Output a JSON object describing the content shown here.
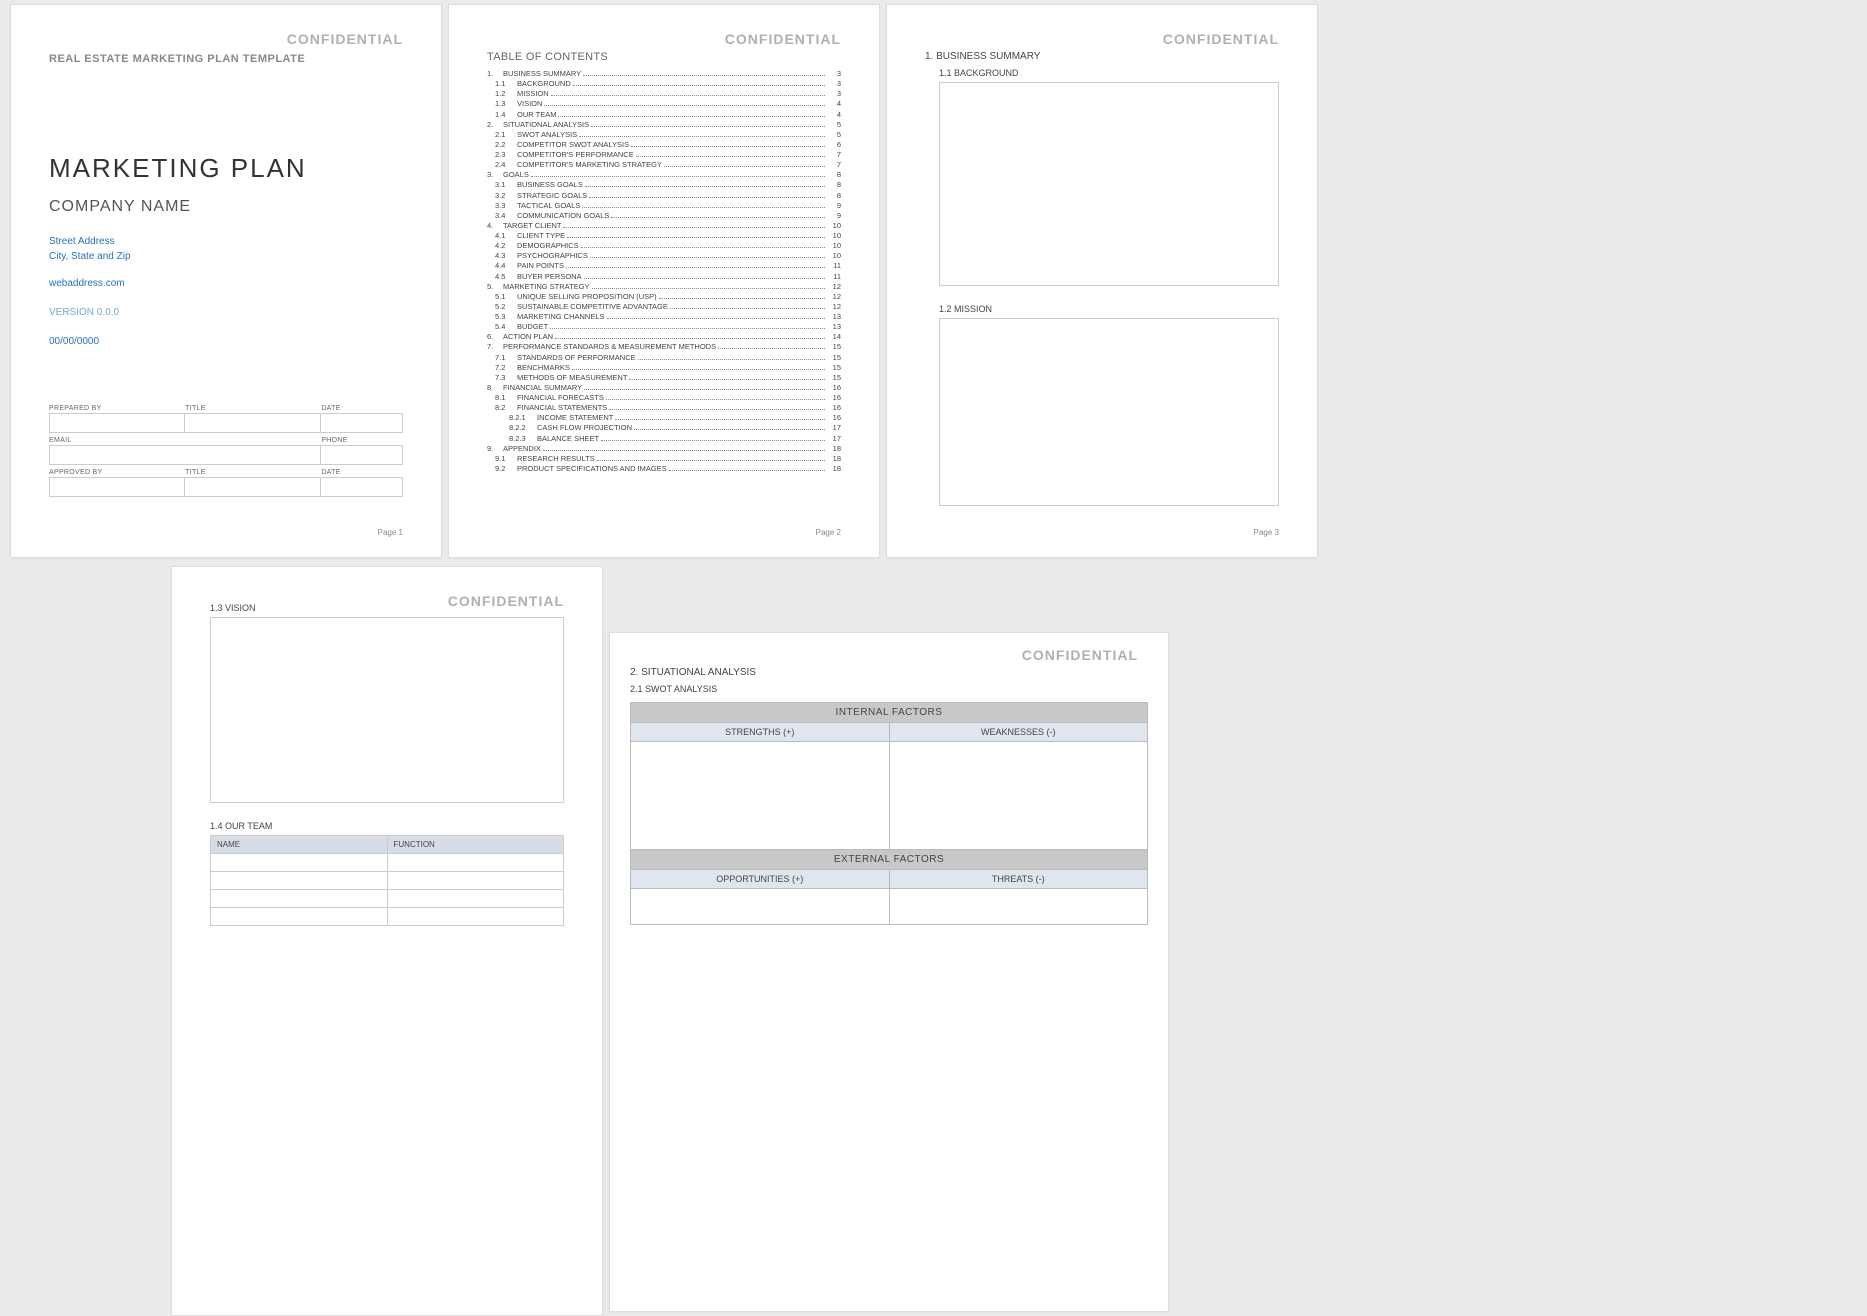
{
  "confidential": "CONFIDENTIAL",
  "page1": {
    "subtitle": "REAL ESTATE MARKETING PLAN TEMPLATE",
    "title": "MARKETING PLAN",
    "company": "COMPANY NAME",
    "street": "Street Address",
    "city": "City, State and Zip",
    "web": "webaddress.com",
    "version": "VERSION 0.0.0",
    "date": "00/00/0000",
    "form": {
      "prepared_by": "PREPARED BY",
      "title": "TITLE",
      "date_label": "DATE",
      "email": "EMAIL",
      "phone": "PHONE",
      "approved_by": "APPROVED BY"
    },
    "page_num": "Page 1"
  },
  "page2": {
    "toc_title": "TABLE OF CONTENTS",
    "toc": [
      {
        "lvl": 1,
        "n": "1.",
        "t": "BUSINESS SUMMARY",
        "p": "3"
      },
      {
        "lvl": 2,
        "n": "1.1",
        "t": "BACKGROUND",
        "p": "3"
      },
      {
        "lvl": 2,
        "n": "1.2",
        "t": "MISSION",
        "p": "3"
      },
      {
        "lvl": 2,
        "n": "1.3",
        "t": "VISION",
        "p": "4"
      },
      {
        "lvl": 2,
        "n": "1.4",
        "t": "OUR TEAM",
        "p": "4"
      },
      {
        "lvl": 1,
        "n": "2.",
        "t": "SITUATIONAL ANALYSIS",
        "p": "5"
      },
      {
        "lvl": 2,
        "n": "2.1",
        "t": "SWOT ANALYSIS",
        "p": "5"
      },
      {
        "lvl": 2,
        "n": "2.2",
        "t": "COMPETITOR SWOT ANALYSIS",
        "p": "6"
      },
      {
        "lvl": 2,
        "n": "2.3",
        "t": "COMPETITOR'S PERFORMANCE",
        "p": "7"
      },
      {
        "lvl": 2,
        "n": "2.4",
        "t": "COMPETITOR'S MARKETING STRATEGY",
        "p": "7"
      },
      {
        "lvl": 1,
        "n": "3.",
        "t": "GOALS",
        "p": "8"
      },
      {
        "lvl": 2,
        "n": "3.1",
        "t": "BUSINESS GOALS",
        "p": "8"
      },
      {
        "lvl": 2,
        "n": "3.2",
        "t": "STRATEGIC GOALS",
        "p": "8"
      },
      {
        "lvl": 2,
        "n": "3.3",
        "t": "TACTICAL GOALS",
        "p": "9"
      },
      {
        "lvl": 2,
        "n": "3.4",
        "t": "COMMUNICATION GOALS",
        "p": "9"
      },
      {
        "lvl": 1,
        "n": "4.",
        "t": "TARGET CLIENT",
        "p": "10"
      },
      {
        "lvl": 2,
        "n": "4.1",
        "t": "CLIENT TYPE",
        "p": "10"
      },
      {
        "lvl": 2,
        "n": "4.2",
        "t": "DEMOGRAPHICS",
        "p": "10"
      },
      {
        "lvl": 2,
        "n": "4.3",
        "t": "PSYCHOGRAPHICS",
        "p": "10"
      },
      {
        "lvl": 2,
        "n": "4.4",
        "t": "PAIN POINTS",
        "p": "11"
      },
      {
        "lvl": 2,
        "n": "4.5",
        "t": "BUYER PERSONA",
        "p": "11"
      },
      {
        "lvl": 1,
        "n": "5.",
        "t": "MARKETING STRATEGY",
        "p": "12"
      },
      {
        "lvl": 2,
        "n": "5.1",
        "t": "UNIQUE SELLING PROPOSITION (USP)",
        "p": "12"
      },
      {
        "lvl": 2,
        "n": "5.2",
        "t": "SUSTAINABLE COMPETITIVE ADVANTAGE",
        "p": "12"
      },
      {
        "lvl": 2,
        "n": "5.3",
        "t": "MARKETING CHANNELS",
        "p": "13"
      },
      {
        "lvl": 2,
        "n": "5.4",
        "t": "BUDGET",
        "p": "13"
      },
      {
        "lvl": 1,
        "n": "6.",
        "t": "ACTION PLAN",
        "p": "14"
      },
      {
        "lvl": 1,
        "n": "7.",
        "t": "PERFORMANCE STANDARDS & MEASUREMENT METHODS",
        "p": "15"
      },
      {
        "lvl": 2,
        "n": "7.1",
        "t": "STANDARDS OF PERFORMANCE",
        "p": "15"
      },
      {
        "lvl": 2,
        "n": "7.2",
        "t": "BENCHMARKS",
        "p": "15"
      },
      {
        "lvl": 2,
        "n": "7.3",
        "t": "METHODS OF MEASUREMENT",
        "p": "15"
      },
      {
        "lvl": 1,
        "n": "8.",
        "t": "FINANCIAL SUMMARY",
        "p": "16"
      },
      {
        "lvl": 2,
        "n": "8.1",
        "t": "FINANCIAL FORECASTS",
        "p": "16"
      },
      {
        "lvl": 2,
        "n": "8.2",
        "t": "FINANCIAL STATEMENTS",
        "p": "16"
      },
      {
        "lvl": 3,
        "n": "8.2.1",
        "t": "INCOME STATEMENT",
        "p": "16"
      },
      {
        "lvl": 3,
        "n": "8.2.2",
        "t": "CASH FLOW PROJECTION",
        "p": "17"
      },
      {
        "lvl": 3,
        "n": "8.2.3",
        "t": "BALANCE SHEET",
        "p": "17"
      },
      {
        "lvl": 1,
        "n": "9.",
        "t": "APPENDIX",
        "p": "18"
      },
      {
        "lvl": 2,
        "n": "9.1",
        "t": "RESEARCH RESULTS",
        "p": "18"
      },
      {
        "lvl": 2,
        "n": "9.2",
        "t": "PRODUCT SPECIFICATIONS AND IMAGES",
        "p": "18"
      }
    ],
    "page_num": "Page 2"
  },
  "page3": {
    "h1": "1.  BUSINESS SUMMARY",
    "h2a": "1.1  BACKGROUND",
    "h2b": "1.2  MISSION",
    "page_num": "Page 3"
  },
  "page4": {
    "h2a": "1.3  VISION",
    "h2b": "1.4  OUR TEAM",
    "team_name": "NAME",
    "team_func": "FUNCTION"
  },
  "page5": {
    "h1": "2.  SITUATIONAL ANALYSIS",
    "h2": "2.1  SWOT ANALYSIS",
    "internal": "INTERNAL FACTORS",
    "external": "EXTERNAL FACTORS",
    "strengths": "STRENGTHS (+)",
    "weaknesses": "WEAKNESSES (-)",
    "opportunities": "OPPORTUNITIES (+)",
    "threats": "THREATS (-)"
  }
}
